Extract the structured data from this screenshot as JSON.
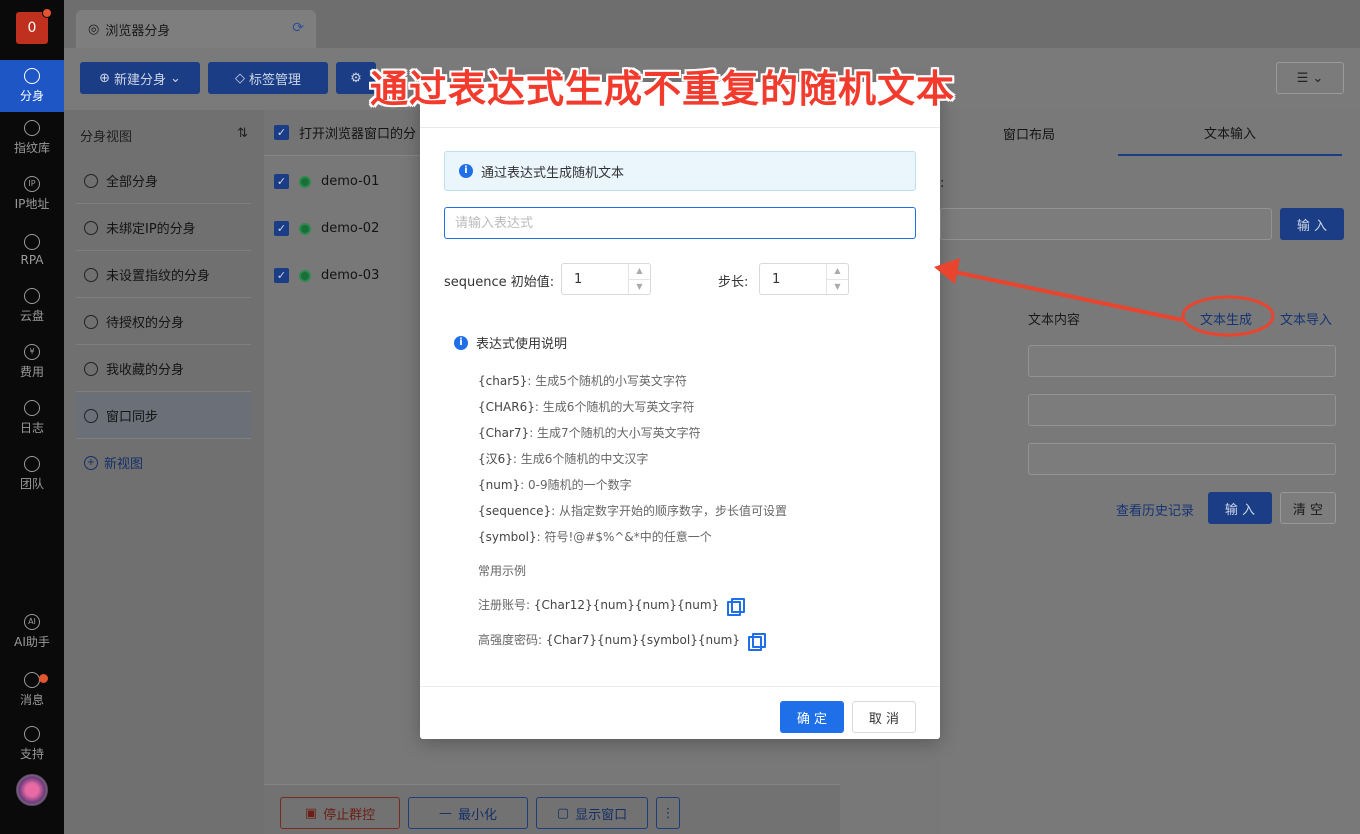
{
  "rail": {
    "logo": "0",
    "items": [
      {
        "label": "分身",
        "icon": "chrome-icon",
        "active": true
      },
      {
        "label": "指纹库",
        "icon": "fingerprint-icon"
      },
      {
        "label": "IP地址",
        "icon": "ip-icon"
      },
      {
        "label": "RPA",
        "icon": "rpa-icon"
      },
      {
        "label": "云盘",
        "icon": "cloud-drive-icon"
      },
      {
        "label": "费用",
        "icon": "yen-icon"
      },
      {
        "label": "日志",
        "icon": "log-icon"
      },
      {
        "label": "团队",
        "icon": "team-icon"
      },
      {
        "label": "AI助手",
        "icon": "ai-icon"
      },
      {
        "label": "消息",
        "icon": "bell-icon"
      },
      {
        "label": "支持",
        "icon": "headset-icon"
      }
    ]
  },
  "tab": {
    "label": "浏览器分身"
  },
  "toolbar": {
    "new_profile": "新建分身",
    "tag_manage": "标签管理"
  },
  "views": {
    "title": "分身视图",
    "items": [
      "全部分身",
      "未绑定IP的分身",
      "未设置指纹的分身",
      "待授权的分身",
      "我收藏的分身",
      "窗口同步"
    ],
    "new_view": "新视图"
  },
  "table": {
    "header": "打开浏览器窗口的分",
    "rows": [
      "demo-01",
      "demo-02",
      "demo-03"
    ]
  },
  "bottom": {
    "stop": "停止群控",
    "minimize": "最小化",
    "show": "显示窗口"
  },
  "right": {
    "tab_layout": "窗口布局",
    "tab_text": "文本输入",
    "colon": ":",
    "input_btn": "输 入",
    "col_content": "文本内容",
    "link_generate": "文本生成",
    "link_import": "文本导入",
    "history": "查看历史记录",
    "input_btn2": "输 入",
    "clear_btn": "清 空"
  },
  "modal": {
    "info": "通过表达式生成随机文本",
    "placeholder": "请输入表达式",
    "seq_label": "sequence 初始值:",
    "seq_value": "1",
    "step_label": "步长:",
    "step_value": "1",
    "guide_title": "表达式使用说明",
    "guide": [
      {
        "key": "{char5}",
        "desc": ": 生成5个随机的小写英文字符"
      },
      {
        "key": "{CHAR6}",
        "desc": ": 生成6个随机的大写英文字符"
      },
      {
        "key": "{Char7}",
        "desc": ": 生成7个随机的大小写英文字符"
      },
      {
        "key": "{汉6}",
        "desc": ": 生成6个随机的中文汉字"
      },
      {
        "key": "{num}",
        "desc": ": 0-9随机的一个数字"
      },
      {
        "key": "{sequence}",
        "desc": ": 从指定数字开始的顺序数字，步长值可设置"
      },
      {
        "key": "{symbol}",
        "desc": ": 符号!@#$%^&*中的任意一个"
      }
    ],
    "examples_title": "常用示例",
    "example1_label": "注册账号:",
    "example1_value": "{Char12}{num}{num}{num}",
    "example2_label": "高强度密码:",
    "example2_value": "{Char7}{num}{symbol}{num}",
    "ok": "确 定",
    "cancel": "取 消"
  },
  "caption": "通过表达式生成不重复的随机文本",
  "colors": {
    "primary": "#1e6fe8",
    "caption": "#f23a2d",
    "annotation": "#e8442e"
  }
}
